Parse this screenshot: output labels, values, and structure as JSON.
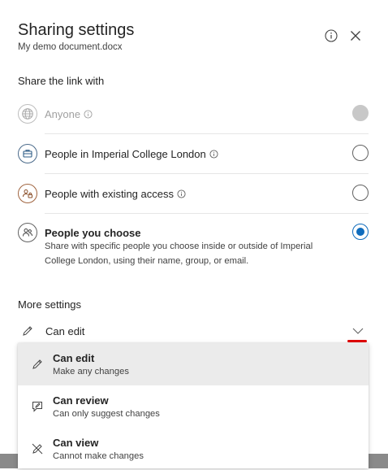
{
  "header": {
    "title": "Sharing settings",
    "subtitle": "My demo document.docx",
    "info_icon": "info-icon",
    "close_icon": "close-icon"
  },
  "share_section": {
    "label": "Share the link with",
    "options": [
      {
        "label": "Anyone",
        "icon": "globe-icon",
        "state": "disabled",
        "has_info": true
      },
      {
        "label": "People in Imperial College London",
        "icon": "organization-icon",
        "state": "unchecked",
        "has_info": true
      },
      {
        "label": "People with existing access",
        "icon": "people-lock-icon",
        "state": "unchecked",
        "has_info": true
      },
      {
        "label": "People you choose",
        "icon": "people-icon",
        "state": "checked",
        "has_info": false,
        "description": "Share with specific people you choose inside or outside of Imperial College London, using their name, group, or email."
      }
    ]
  },
  "more_settings": {
    "label": "More settings",
    "permission_value": "Can edit",
    "menu": [
      {
        "title": "Can edit",
        "subtitle": "Make any changes",
        "icon": "pencil-icon",
        "selected": true
      },
      {
        "title": "Can review",
        "subtitle": "Can only suggest changes",
        "icon": "review-icon",
        "selected": false
      },
      {
        "title": "Can view",
        "subtitle": "Cannot make changes",
        "icon": "no-edit-icon",
        "selected": false
      }
    ]
  },
  "colors": {
    "accent": "#0f6cbd",
    "annotation_red": "#e00000",
    "selected_bg": "#ebebeb"
  }
}
